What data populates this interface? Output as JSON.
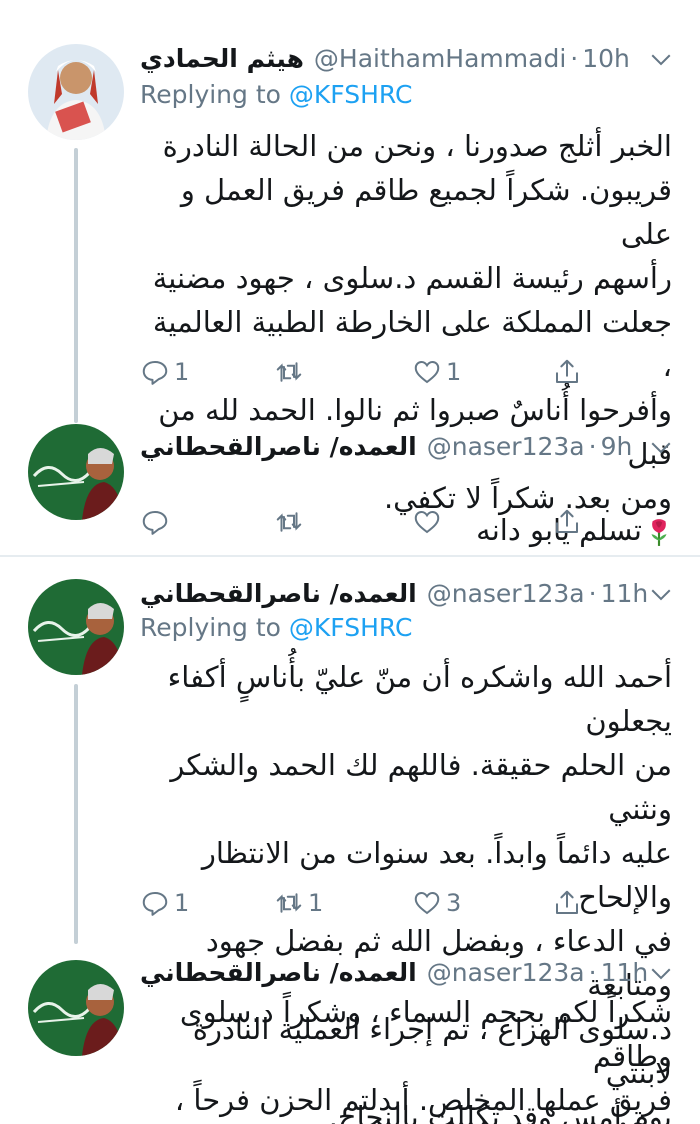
{
  "tweets": [
    {
      "display_name": "هيثم الحمادي",
      "handle": "@HaithamHammadi",
      "time": "10h",
      "replying_prefix": "Replying to",
      "replying_to": "@KFSHRC",
      "text": "الخبر أثلج صدورنا ، ونحن من الحالة النادرة\nقريبون. شكراً لجميع طاقم فريق العمل و على\nرأسهم رئيسة القسم د.سلوى ، جهود مضنية\nجعلت المملكة على الخارطة الطبية العالمية ،\nوأفرحوا أُناسٌ صبروا ثم نالوا. الحمد لله من قبل\nومن بعد. شكراً لا تكفي.",
      "reply_count": "1",
      "retweet_count": "",
      "like_count": "1"
    },
    {
      "display_name": "العمده/ ناصرالقحطاني",
      "handle": "@naser123a",
      "time": "9h",
      "text": "تسلم يابو دانه",
      "reply_count": "",
      "retweet_count": "",
      "like_count": ""
    },
    {
      "display_name": "العمده/ ناصرالقحطاني",
      "handle": "@naser123a",
      "time": "11h",
      "replying_prefix": "Replying to",
      "replying_to": "@KFSHRC",
      "text": "أحمد الله واشكره أن منّ عليّ بأُناسٍ أكفاء يجعلون\nمن الحلم حقيقة. فاللهم لك الحمد والشكر ونثني\nعليه دائماً وابداً. بعد سنوات من الانتظار والإلحاح\nفي الدعاء ، وبفضل الله ثم بفضل جهود ومتابعة\nد.سلوى الهزاع ، تم إجراء العملية النادرة لابنتي\nيوم أمس وقد تكللت بالنجاح.",
      "reply_count": "1",
      "retweet_count": "1",
      "like_count": "3"
    },
    {
      "display_name": "العمده/ ناصرالقحطاني",
      "handle": "@naser123a",
      "time": "11h",
      "text": "شكراً لكم بحجم السماء ، وشكراً د.سلوى وطاقم\nفريق عملها المخلص. أبدلتم الحزن فرحاً ،\nوالظُلمة نوراً ، والحلم حقيقة"
    }
  ],
  "icons": {
    "reply": "reply-icon",
    "retweet": "retweet-icon",
    "like": "heart-icon",
    "share": "share-icon",
    "menu": "chevron-down-icon",
    "emoji": "rose-emoji-icon"
  },
  "colors": {
    "link": "#1da1f2",
    "secondary": "#657786",
    "thread_line": "#c4cfd6"
  }
}
